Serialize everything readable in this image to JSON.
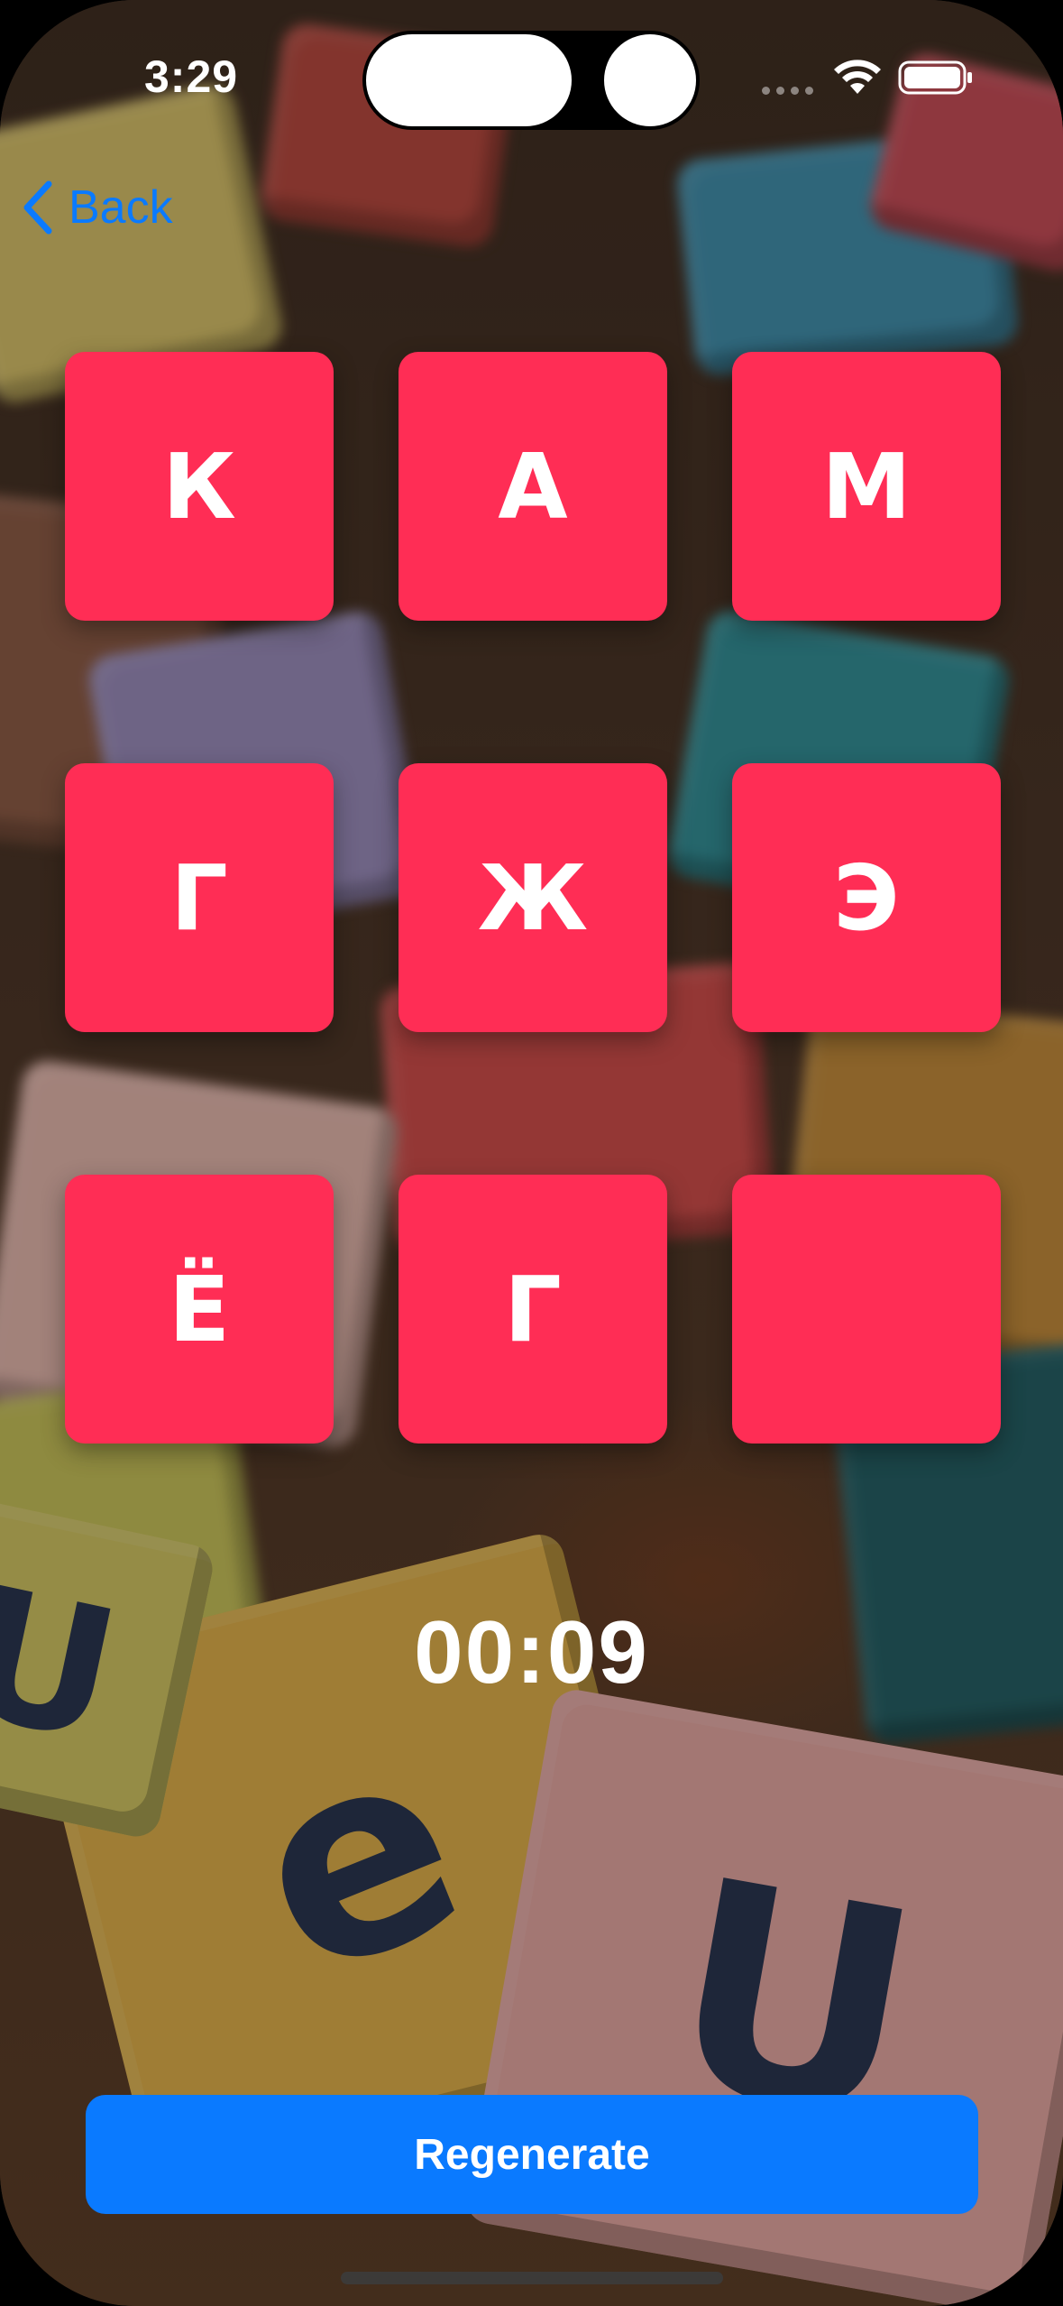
{
  "status_bar": {
    "time": "3:29",
    "icons": [
      "signal-dots-icon",
      "wifi-icon",
      "battery-icon"
    ]
  },
  "nav": {
    "back_label": "Back",
    "back_icon": "chevron-left-icon"
  },
  "grid": {
    "tiles": [
      {
        "letter": "К"
      },
      {
        "letter": "А"
      },
      {
        "letter": "М"
      },
      {
        "letter": "Г"
      },
      {
        "letter": "Ж"
      },
      {
        "letter": "Э"
      },
      {
        "letter": "Ё"
      },
      {
        "letter": "Г"
      },
      {
        "letter": ""
      }
    ]
  },
  "timer": {
    "value": "00:09"
  },
  "actions": {
    "regenerate_label": "Regenerate"
  },
  "colors": {
    "tile": "#ff2d55",
    "accent": "#0a7aff",
    "text_light": "#ffffff"
  }
}
